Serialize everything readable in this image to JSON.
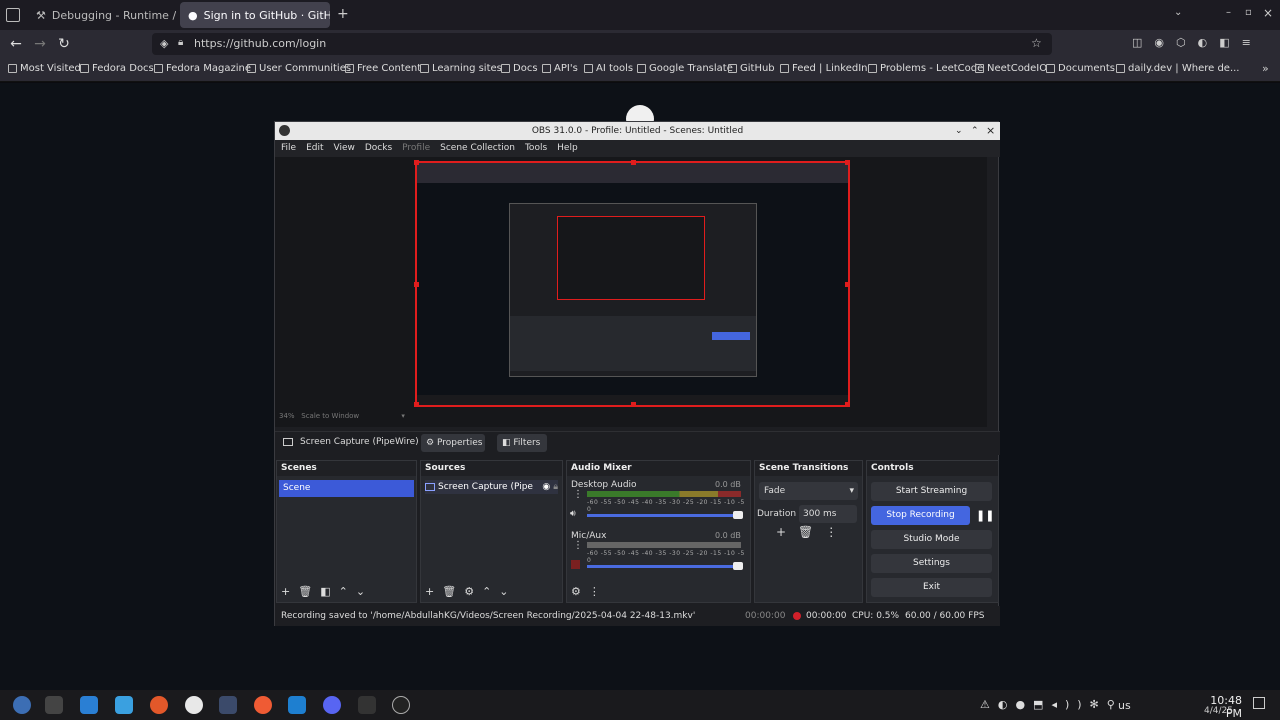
{
  "browser": {
    "tabs": [
      {
        "label": "Debugging - Runtime / thi"
      },
      {
        "label": "Sign in to GitHub · GitHub"
      }
    ],
    "new_tab": "+",
    "url": "https://github.com/login",
    "bookmarks": [
      "Most Visited",
      "Fedora Docs",
      "Fedora Magazine",
      "User Communities",
      "Free Content",
      "Learning sites",
      "Docs",
      "API's",
      "AI tools",
      "Google Translate",
      "GitHub",
      "Feed | LinkedIn",
      "Problems - LeetCode",
      "NeetCodeIO",
      "Documents",
      "daily.dev | Where de..."
    ]
  },
  "obs": {
    "title": "OBS 31.0.0 - Profile: Untitled - Scenes: Untitled",
    "menu": [
      "File",
      "Edit",
      "View",
      "Docks",
      "Profile",
      "Scene Collection",
      "Tools",
      "Help"
    ],
    "preview_zoom": "34%",
    "preview_scale": "Scale to Window",
    "source_name": "Screen Capture (PipeWire)",
    "properties": "Properties",
    "filters": "Filters",
    "scenes_title": "Scenes",
    "scene": "Scene",
    "sources_title": "Sources",
    "source_item": "Screen Capture (Pipe",
    "mixer_title": "Audio Mixer",
    "desktop_audio": "Desktop Audio",
    "desktop_db": "0.0 dB",
    "mic": "Mic/Aux",
    "mic_db": "0.0 dB",
    "scale_text": "-60 -55 -50 -45 -40 -35 -30 -25 -20 -15 -10 -5 0",
    "transitions_title": "Scene Transitions",
    "transition": "Fade",
    "duration_label": "Duration",
    "duration": "300 ms",
    "controls_title": "Controls",
    "controls": [
      "Start Streaming",
      "Stop Recording",
      "Studio Mode",
      "Settings",
      "Exit"
    ],
    "status_msg": "Recording saved to '/home/AbdullahKG/Videos/Screen Recording/2025-04-04 22-48-13.mkv'",
    "stream_time": "00:00:00",
    "rec_time": "00:00:00",
    "cpu": "CPU: 0.5%",
    "fps": "60.00 / 60.00 FPS"
  },
  "taskbar": {
    "kbd": "us",
    "time": "10:48 PM",
    "date": "4/4/25"
  }
}
